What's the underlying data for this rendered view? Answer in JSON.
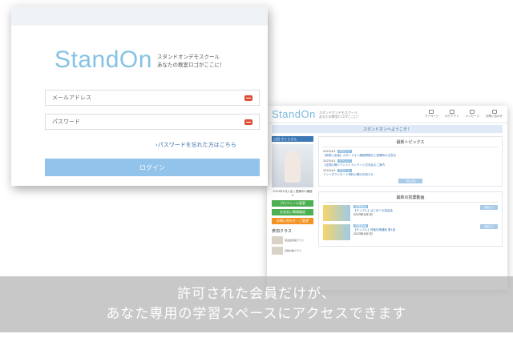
{
  "login": {
    "logo": "StandOn",
    "tagline_1": "スタンドオンデモスクール",
    "tagline_2": "あなたの教室ロゴがここに！",
    "email_placeholder": "メールアドレス",
    "password_placeholder": "パスワード",
    "forgot_link": "›パスワードを忘れた方はこちら",
    "login_button": "ログイン"
  },
  "dashboard": {
    "logo": "StandOn",
    "tagline_1": "スタンドオンデモスクール",
    "tagline_2": "あなたの教室ロゴがここに！",
    "banner": "スタンドオンへようこそ！",
    "nav": [
      "マイページ",
      "ログアウト",
      "メッセージ",
      "お問い合わせ"
    ],
    "user_name": "山田 さくらさん",
    "user_meta": "2023年1月入会 | 受講中の講座 3",
    "btn_profile": "プロフィール変更",
    "btn_payment": "お支払い情報確認",
    "btn_other": "お問い合わせ・ご要望",
    "classes_title": "参加クラス",
    "classes": [
      "英会話初級クラス",
      "資格対策クラス"
    ],
    "news_title": "最新トピックス",
    "news": [
      {
        "date": "2023/4/1",
        "tag": "お知らせ",
        "link": "【新規入会者】スタンドオン講座開講日と受講時の注意点"
      },
      {
        "date": "2023/4/1",
        "tag": "イベント",
        "link": "【定期公開イベント】オンライン交流会のご案内"
      },
      {
        "date": "2023/4/1",
        "tag": "お知らせ",
        "link": "フリーダウンロード資料公開のお知らせ"
      }
    ],
    "news_more": "一覧を見る",
    "videos_title": "最新の授業動画",
    "videos": [
      {
        "tag": "授業動画",
        "title": "【サンプル】はじめての英会話",
        "date": "2023年4月1日",
        "button": "視聴する"
      },
      {
        "tag": "授業動画",
        "title": "【サンプル】資格対策講座 第1回",
        "date": "2023年4月1日",
        "button": "視聴する"
      }
    ]
  },
  "caption": {
    "line_1": "許可された会員だけが、",
    "line_2": "あなた専用の学習スペースにアクセスできます"
  }
}
